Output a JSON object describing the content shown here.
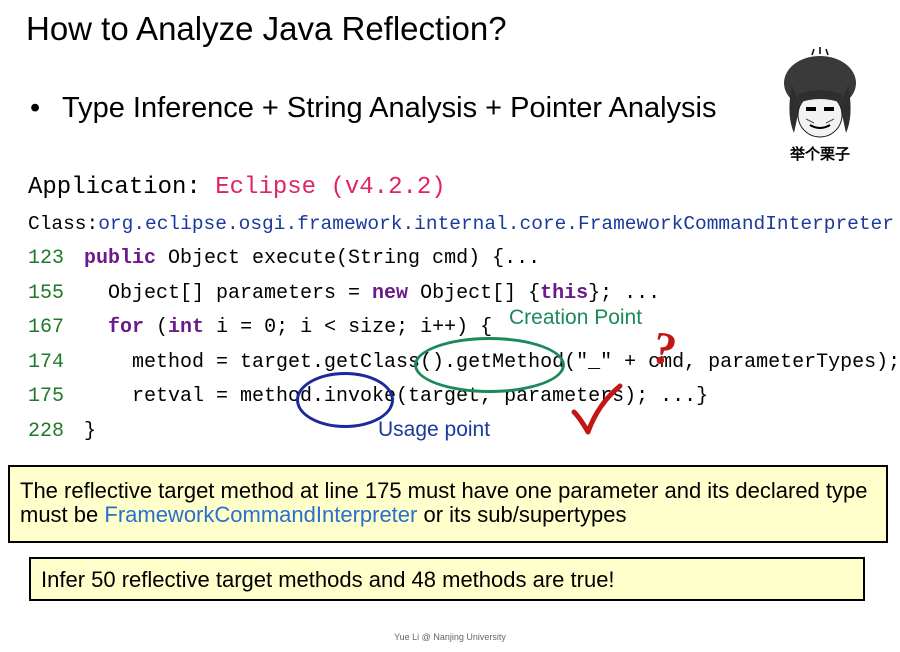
{
  "slide": {
    "title": "How to Analyze Java Reflection?",
    "bullet_marker": "•",
    "bullet": "Type Inference + String Analysis + Pointer Analysis",
    "app_label": "Application: ",
    "app_value": "Eclipse (v4.2.2)",
    "class_label": "Class:",
    "class_value": "org.eclipse.osgi.framework.internal.core.FrameworkCommandInterpreter",
    "code": [
      {
        "ln": "123",
        "pre": "",
        "kw1": "public",
        "rest": " Object execute(String cmd) {..."
      },
      {
        "ln": "155",
        "pre": "  Object[] parameters = ",
        "kw1": "new",
        "mid": " Object[] {",
        "kw2": "this",
        "rest": "}; ..."
      },
      {
        "ln": "167",
        "pre": "  ",
        "kw1": "for",
        "mid": " (",
        "kw2": "int",
        "rest": " i = 0; i < size; i++) {"
      },
      {
        "ln": "174",
        "text": "    method = target.getClass().getMethod(\"_\" + cmd, parameterTypes);"
      },
      {
        "ln": "175",
        "text": "    retval = method.invoke(target, parameters); ...}"
      },
      {
        "ln": "228",
        "text": "}"
      }
    ],
    "annotation_creation": "Creation Point",
    "annotation_usage": "Usage point",
    "question_mark": "?",
    "box1_part1": "The reflective target method at line 175 must have one parameter and its declared type must be ",
    "box1_highlight": "FrameworkCommandInterpreter",
    "box1_part2": " or its sub/supertypes",
    "box2": "Infer 50 reflective target methods and 48 methods are true!",
    "meme_caption": "举个栗子",
    "footer": "Yue Li @ Nanjing University"
  },
  "colors": {
    "app_value": "#e0245e",
    "class_value": "#1a3a9c",
    "line_numbers": "#1e7a2a",
    "keywords": "#6b1a8a",
    "creation_point": "#1a8a5a",
    "usage_point": "#1a2a9c",
    "question_and_check": "#c01818",
    "box_fill": "#ffffcc",
    "highlight": "#2a6ecf"
  },
  "icons": [
    "meme-sticker",
    "red-checkmark-icon",
    "red-question-mark-icon"
  ]
}
